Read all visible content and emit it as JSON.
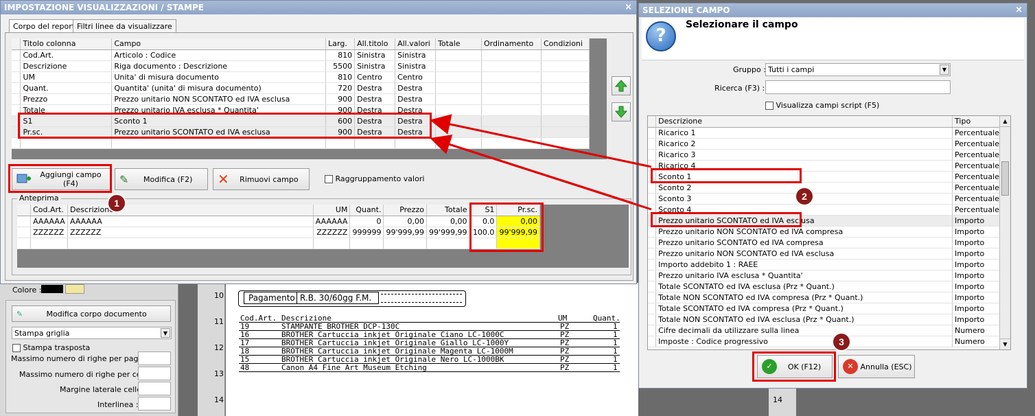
{
  "left_window": {
    "title": "IMPOSTAZIONE VISUALIZZAZIONI / STAMPE",
    "close": "×",
    "tabs": [
      "Corpo del report",
      "Filtri linee da visualizzare"
    ],
    "columns_grid": {
      "headers": [
        "Titolo colonna",
        "Campo",
        "Larg.",
        "All.titolo",
        "All.valori",
        "Totale",
        "Ordinamento",
        "Condizioni"
      ],
      "rows": [
        [
          "Cod.Art.",
          "Articolo : Codice",
          "810",
          "Sinistra",
          "Sinistra",
          "",
          "",
          ""
        ],
        [
          "Descrizione",
          "Riga documento : Descrizione",
          "5500",
          "Sinistra",
          "Sinistra",
          "",
          "",
          ""
        ],
        [
          "UM",
          "Unita' di misura documento",
          "810",
          "Centro",
          "Centro",
          "",
          "",
          ""
        ],
        [
          "Quant.",
          "Quantita' (unita' di misura documento)",
          "720",
          "Destra",
          "Destra",
          "",
          "",
          ""
        ],
        [
          "Prezzo",
          "Prezzo unitario NON SCONTATO ed IVA esclusa",
          "900",
          "Destra",
          "Destra",
          "",
          "",
          ""
        ],
        [
          "Totale",
          "Prezzo unitario IVA esclusa * Quantita'",
          "900",
          "Destra",
          "Destra",
          "",
          "",
          ""
        ],
        [
          "S1",
          "Sconto 1",
          "600",
          "Destra",
          "Destra",
          "",
          "",
          ""
        ],
        [
          "Pr.sc.",
          "Prezzo unitario SCONTATO ed IVA esclusa",
          "900",
          "Destra",
          "Destra",
          "",
          "",
          ""
        ]
      ]
    },
    "buttons": {
      "add": "Aggiungi campo (F4)",
      "edit": "Modifica (F2)",
      "remove": "Rimuovi campo",
      "grouping": "Raggruppamento valori"
    },
    "preview": {
      "label": "Anteprima",
      "headers": [
        "Cod.Art.",
        "Descrizione",
        "UM",
        "Quant.",
        "Prezzo",
        "Totale",
        "S1",
        "Pr.sc."
      ],
      "rows": [
        [
          "AAAAAA",
          "AAAAAA",
          "AAAAAA",
          "0",
          "0,00",
          "0,00",
          "0.0",
          "0,00"
        ],
        [
          "ZZZZZZ",
          "ZZZZZZ",
          "ZZZZZZ",
          "999999",
          "99'999,99",
          "99'999,99",
          "100.0",
          "99'999,99"
        ]
      ]
    },
    "badge1": "1"
  },
  "background": {
    "colore_label": "Colore :",
    "modifica_corpo": "Modifica corpo documento",
    "stampa_select": "Stampa griglia",
    "stampa_trasposta": "Stampa trasposta",
    "fields": [
      "Massimo numero di righe per pagina :",
      "Massimo numero di righe per cella :",
      "Margine laterale celle :",
      "Interlinea :"
    ],
    "ruler": [
      "10",
      "11",
      "12",
      "13",
      "14",
      "14"
    ],
    "pagamento_label": "Pagamento",
    "pagamento_value": "R.B. 30/60gg F.M.",
    "doc_headers": [
      "Cod.Art.",
      "Descrizione",
      "UM",
      "Quant."
    ],
    "doc_rows": [
      [
        "19",
        "STAMPANTE BROTHER DCP-130C",
        "PZ",
        "1"
      ],
      [
        "16",
        "BROTHER Cartuccia inkjet Originale Ciano LC-1000C",
        "PZ",
        "1"
      ],
      [
        "17",
        "BROTHER Cartuccia inkjet Originale Giallo LC-1000Y",
        "PZ",
        "1"
      ],
      [
        "18",
        "BROTHER Cartuccia inkjet Originale Magenta LC-1000M",
        "PZ",
        "1"
      ],
      [
        "15",
        "BROTHER Cartuccia inkjet Originale Nero LC-1000BK",
        "PZ",
        "1"
      ],
      [
        "48",
        "Canon A4 Fine Art Museum Etching",
        "PZ",
        "1"
      ]
    ]
  },
  "right_window": {
    "title": "SELEZIONE CAMPO",
    "close": "×",
    "heading": "Selezionare il campo",
    "gruppo_label": "Gruppo :",
    "gruppo_value": "Tutti i campi",
    "ricerca_label": "Ricerca (F3) :",
    "ricerca_value": "",
    "script_label": "Visualizza campi script (F5)",
    "list_headers": [
      "Descrizione",
      "Tipo"
    ],
    "list_rows": [
      [
        "Ricarico 1",
        "Percentuale"
      ],
      [
        "Ricarico 2",
        "Percentuale"
      ],
      [
        "Ricarico 3",
        "Percentuale"
      ],
      [
        "Ricarico 4",
        "Percentuale"
      ],
      [
        "Sconto 1",
        "Percentuale"
      ],
      [
        "Sconto 2",
        "Percentuale"
      ],
      [
        "Sconto 3",
        "Percentuale"
      ],
      [
        "Sconto 4",
        "Percentuale"
      ],
      [
        "Prezzo unitario SCONTATO ed IVA esclusa",
        "Importo"
      ],
      [
        "Prezzo unitario NON SCONTATO ed IVA compresa",
        "Importo"
      ],
      [
        "Prezzo unitario SCONTATO ed IVA compresa",
        "Importo"
      ],
      [
        "Prezzo unitario NON SCONTATO ed IVA esclusa",
        "Importo"
      ],
      [
        "Importo addebito 1 : RAEE",
        "Importo"
      ],
      [
        "Prezzo unitario IVA esclusa * Quantita'",
        "Importo"
      ],
      [
        "Totale SCONTATO ed IVA esclusa (Prz * Quant.)",
        "Importo"
      ],
      [
        "Totale NON SCONTATO ed IVA compresa (Prz * Quant.)",
        "Importo"
      ],
      [
        "Totale SCONTATO ed IVA compresa (Prz * Quant.)",
        "Importo"
      ],
      [
        "Totale NON SCONTATO ed IVA esclusa (Prz * Quant.)",
        "Importo"
      ],
      [
        "Cifre decimali da utilizzare sulla linea",
        "Numero"
      ],
      [
        "Imposte : Codice progressivo",
        "Numero"
      ]
    ],
    "ok": "OK (F12)",
    "cancel": "Annulla (ESC)",
    "badge2": "2",
    "badge3": "3"
  },
  "colors": {
    "annotation": "#e00000",
    "badge": "#8b1a1a",
    "highlight": "#ffff00"
  }
}
